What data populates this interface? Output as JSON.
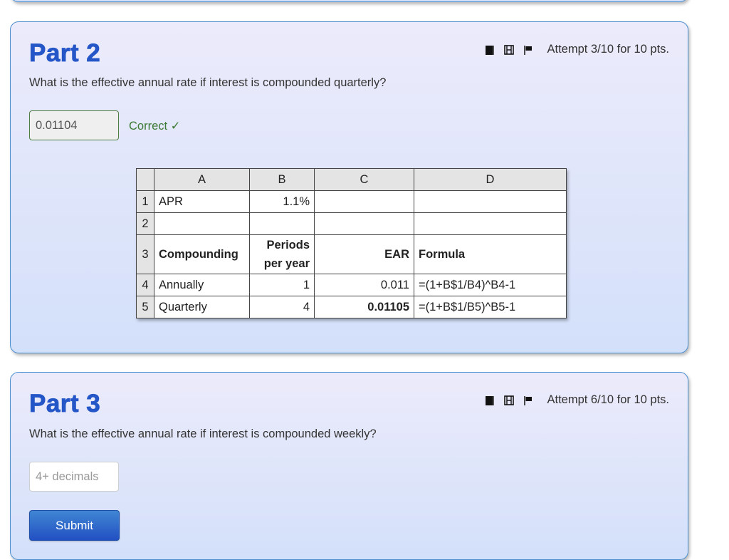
{
  "parts": [
    {
      "title": "Part 2",
      "question": "What is the effective annual rate if interest is compounded quarterly?",
      "attempt_text": "Attempt 3/10 for 10 pts.",
      "icons": [
        "book-icon",
        "film-icon",
        "flag-icon"
      ],
      "answer_value": "0.01104",
      "feedback": "Correct ✓",
      "feedback_color": "#3b7a33",
      "spreadsheet": {
        "columns": [
          "",
          "A",
          "B",
          "C",
          "D"
        ],
        "rows": [
          {
            "num": "1",
            "A": "APR",
            "B": "1.1%",
            "C": "",
            "D": ""
          },
          {
            "num": "2",
            "A": "",
            "B": "",
            "C": "",
            "D": ""
          },
          {
            "num": "3",
            "A": "Compounding",
            "B_line1": "Periods",
            "B_line2": "per year",
            "C": "EAR",
            "D": "Formula"
          },
          {
            "num": "4",
            "A": "Annually",
            "B": "1",
            "C": "0.011",
            "D": "=(1+B$1/B4)^B4-1"
          },
          {
            "num": "5",
            "A": "Quarterly",
            "B": "4",
            "C": "0.01105",
            "D": "=(1+B$1/B5)^B5-1"
          }
        ]
      }
    },
    {
      "title": "Part 3",
      "question": "What is the effective annual rate if interest is compounded weekly?",
      "attempt_text": "Attempt 6/10 for 10 pts.",
      "icons": [
        "book-icon",
        "film-icon",
        "flag-icon"
      ],
      "answer_value": "",
      "answer_placeholder": "4+ decimals",
      "submit_label": "Submit"
    }
  ],
  "colors": {
    "title": "#2456c8",
    "panel_border": "#4a8fd0",
    "submit": "#2a5fc8"
  }
}
